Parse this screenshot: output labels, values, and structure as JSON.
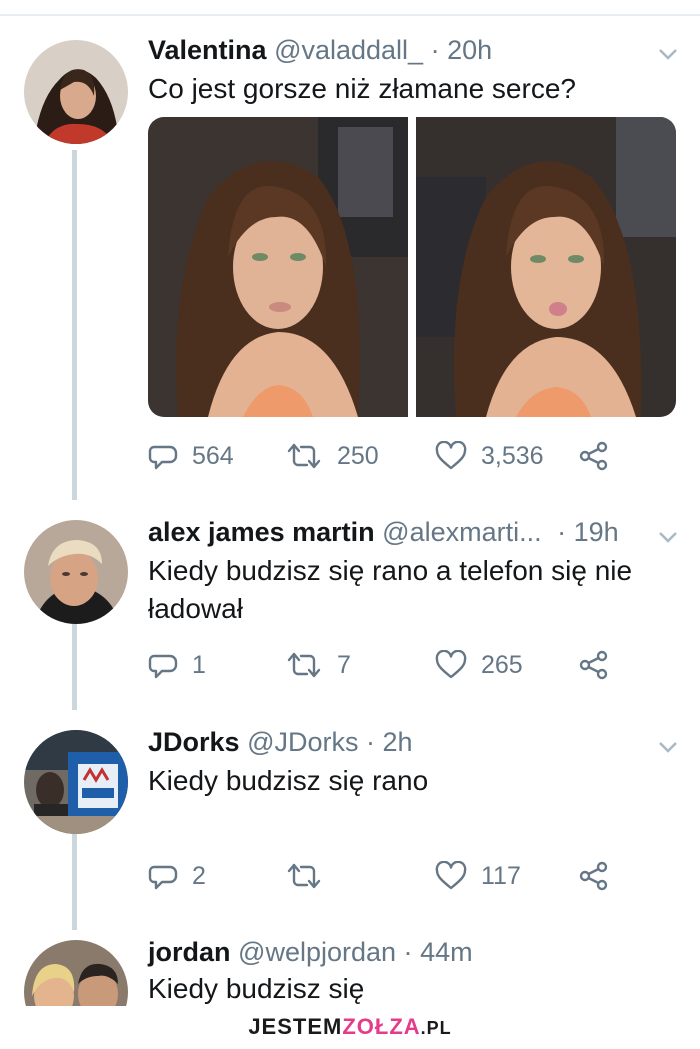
{
  "tweets": [
    {
      "name": "Valentina",
      "handle": "@valaddall_",
      "separator": "·",
      "time": "20h",
      "text": "Co jest gorsze niż złamane serce?",
      "replies": "564",
      "retweets": "250",
      "likes": "3,536"
    },
    {
      "name": "alex james martin",
      "handle": "@alexmarti...",
      "separator": "·",
      "time": "19h",
      "text": "Kiedy budzisz się rano a telefon się nie ładował",
      "replies": "1",
      "retweets": "7",
      "likes": "265"
    },
    {
      "name": "JDorks",
      "handle": "@JDorks",
      "separator": "·",
      "time": "2h",
      "text": "Kiedy budzisz się rano",
      "replies": "2",
      "retweets": "",
      "likes": "117"
    },
    {
      "name": "jordan",
      "handle": "@welpjordan",
      "separator": "·",
      "time": "44m",
      "text": "Kiedy budzisz się"
    }
  ],
  "watermark": {
    "prefix": "JESTEM",
    "middle": "ZOŁZA",
    "suffix": ".PL"
  },
  "icons": {
    "reply": "reply-icon",
    "retweet": "retweet-icon",
    "like": "heart-icon",
    "share": "share-icon",
    "menu": "chevron-down-icon"
  },
  "colors": {
    "text": "#14171a",
    "muted": "#657786",
    "thread": "#ccd6dd",
    "watermark_accent": "#e63a8a"
  }
}
